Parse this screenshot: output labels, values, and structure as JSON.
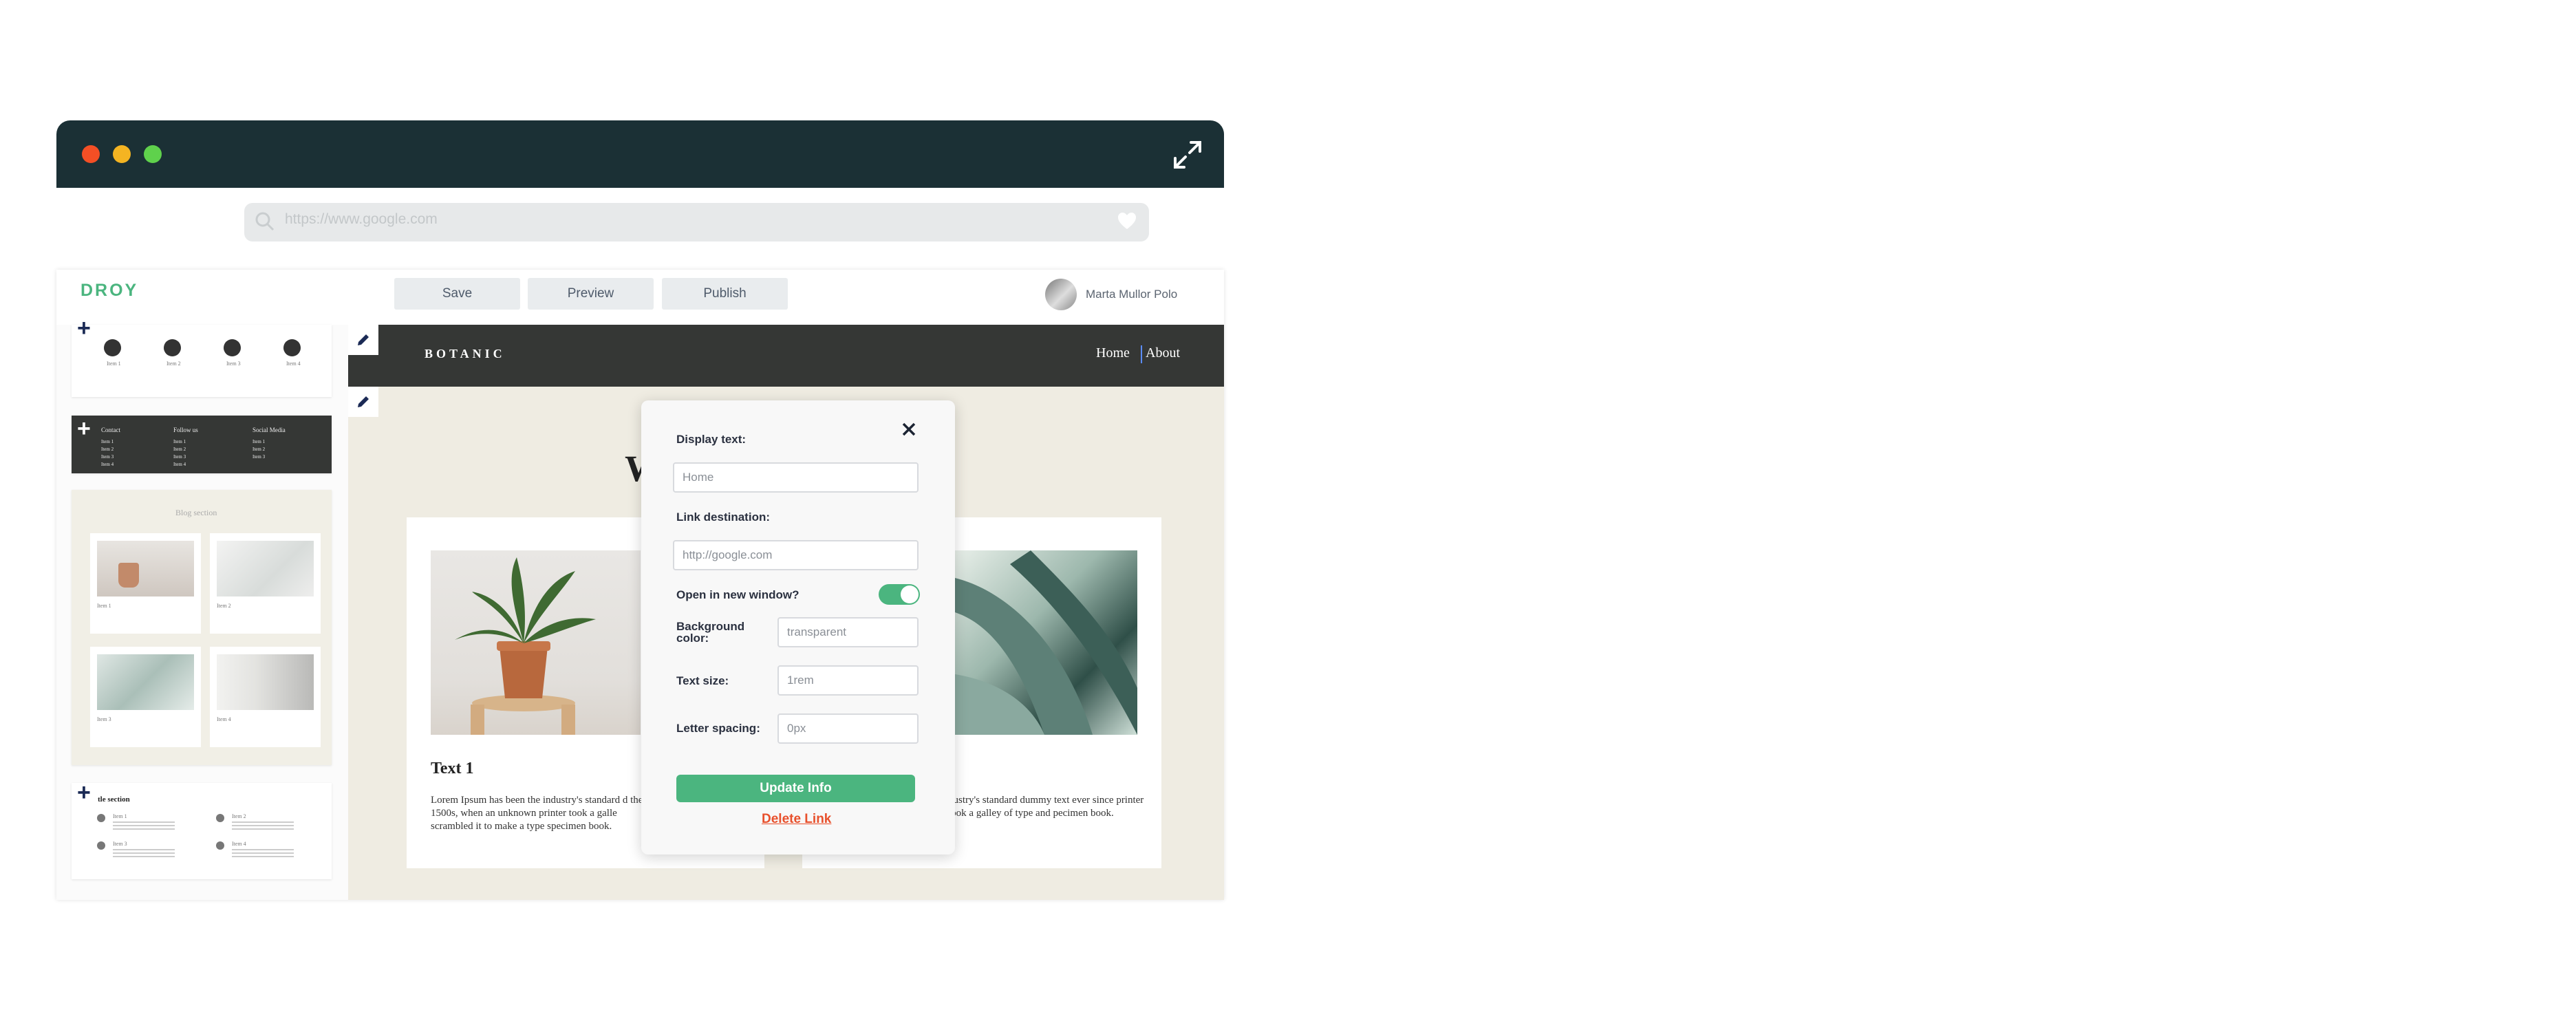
{
  "browser": {
    "url": "https://www.google.com",
    "traffic_lights": {
      "close": "#f44f25",
      "minimize": "#f4b422",
      "maximize": "#5fd14c"
    },
    "titlebar_color": "#1b3035"
  },
  "editor": {
    "logo": "DROY",
    "toolbar": {
      "save_label": "Save",
      "preview_label": "Preview",
      "publish_label": "Publish"
    },
    "user_name": "Marta Mullor Polo",
    "accent_color": "#4bb57f"
  },
  "sidebar": {
    "icons_block": {
      "items": [
        "Item 1",
        "Item 2",
        "Item 3",
        "Item 4"
      ]
    },
    "footer_block": {
      "columns": [
        "Contact",
        "Follow us",
        "Social Media"
      ],
      "rows": [
        "Item 1",
        "Item 2",
        "Item 3",
        "Item 4"
      ]
    },
    "blog_block": {
      "title": "Blog section",
      "items": [
        "Item 1",
        "Item 2",
        "Item 3",
        "Item 4"
      ]
    },
    "list_block": {
      "title": "tle section",
      "items": [
        "Item 1",
        "Item 2",
        "Item 3",
        "Item 4"
      ]
    }
  },
  "site": {
    "brand": "BOTANIC",
    "nav": [
      "Home",
      "About"
    ],
    "heading_partial": "W",
    "card1": {
      "title": "Text 1",
      "body": "Lorem Ipsum has been the industry's standard d the 1500s, when an unknown printer took a galle scrambled it to make a type specimen book."
    },
    "card2": {
      "body": "dustry's standard dummy text ever since printer took a galley of type and pecimen book."
    }
  },
  "link_modal": {
    "display_text_label": "Display text:",
    "display_text_value": "Home",
    "link_destination_label": "Link destination:",
    "link_destination_placeholder": "http://google.com",
    "new_window_label": "Open in new window?",
    "new_window_on": true,
    "background_label": "Background color:",
    "background_value": "transparent",
    "text_size_label": "Text size:",
    "text_size_value": "1rem",
    "letter_spacing_label": "Letter spacing:",
    "letter_spacing_value": "0px",
    "update_label": "Update Info",
    "delete_label": "Delete Link"
  }
}
